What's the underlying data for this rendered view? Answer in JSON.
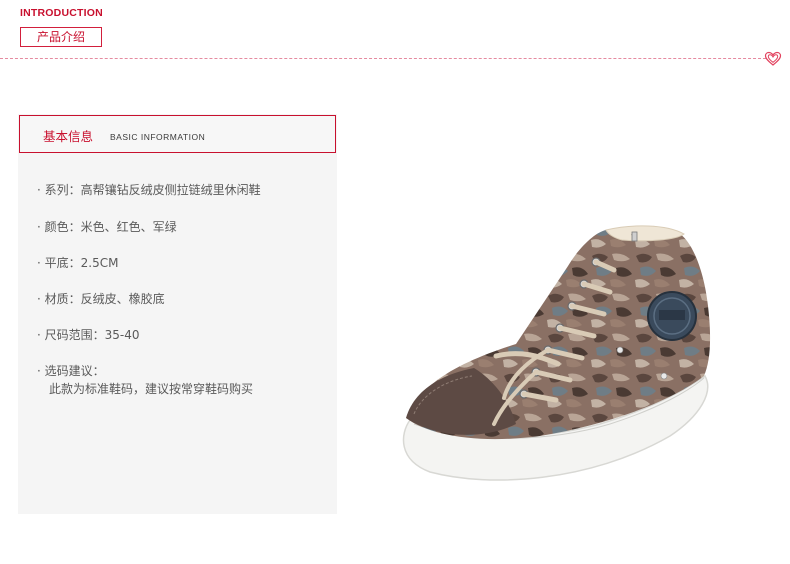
{
  "header": {
    "intro_en": "INTRODUCTION",
    "intro_cn": "产品介绍"
  },
  "basic": {
    "title_cn": "基本信息",
    "title_en": "BASIC INFORMATION"
  },
  "specs": [
    "· 系列：高帮镶钻反绒皮侧拉链绒里休闲鞋",
    "· 颜色：米色、红色、军绿",
    "· 平底：2.5CM",
    "· 材质：反绒皮、橡胶底",
    "· 尺码范围：35-40",
    "· 选码建议："
  ],
  "size_advice": "此款为标准鞋码，建议按常穿鞋码购买",
  "colors": {
    "accent": "#c8102e",
    "dash": "#e58aa0",
    "panel": "#f5f5f5",
    "text": "#5a5a5a"
  },
  "icons": {
    "divider_end": "heart-icon",
    "product": "high-top-sneaker-image"
  }
}
